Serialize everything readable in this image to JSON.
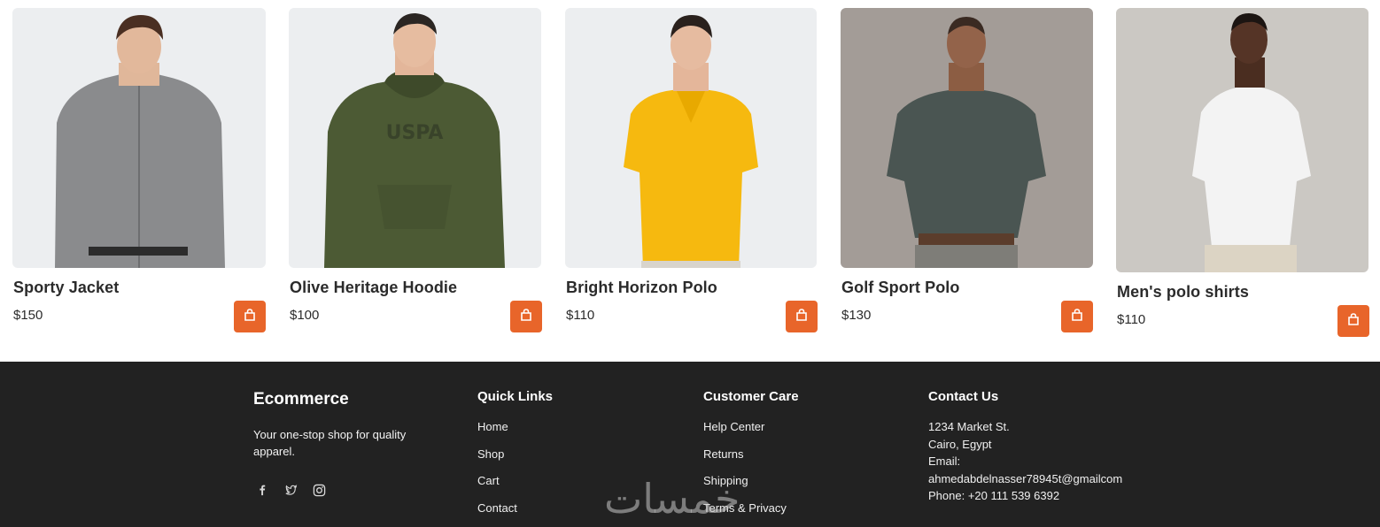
{
  "products": [
    {
      "title": "Sporty Jacket",
      "price": "$150",
      "image": "man-grey-jacket",
      "bg": "#eceef0",
      "garment": "#8a8b8d"
    },
    {
      "title": "Olive Heritage Hoodie",
      "price": "$100",
      "image": "man-olive-hoodie",
      "bg": "#eceef0",
      "garment": "#4c5a34"
    },
    {
      "title": "Bright Horizon Polo",
      "price": "$110",
      "image": "man-yellow-polo",
      "bg": "#eceef0",
      "garment": "#f6b90f"
    },
    {
      "title": "Golf Sport Polo",
      "price": "$130",
      "image": "man-dark-green-polo",
      "bg": "#a39c97",
      "garment": "#4a5552"
    },
    {
      "title": "Men's polo shirts",
      "price": "$110",
      "image": "man-white-polo",
      "bg": "#cbc8c3",
      "garment": "#f3f3f3"
    }
  ],
  "cart_icon": "shopping-bag-icon",
  "accent_color": "#e8652a",
  "footer": {
    "brand": "Ecommerce",
    "tagline": "Your one-stop shop for quality apparel.",
    "socials": [
      "facebook-icon",
      "twitter-icon",
      "instagram-icon"
    ],
    "quick_links": {
      "heading": "Quick Links",
      "items": [
        "Home",
        "Shop",
        "Cart",
        "Contact"
      ]
    },
    "customer_care": {
      "heading": "Customer Care",
      "items": [
        "Help Center",
        "Returns",
        "Shipping",
        "Terms & Privacy"
      ]
    },
    "contact": {
      "heading": "Contact Us",
      "lines": [
        "1234 Market St.",
        "Cairo, Egypt",
        "Email:",
        "ahmedabdelnasser78945t@gmailcom",
        "Phone: +20 111 539 6392"
      ]
    },
    "watermark": "خمسات"
  }
}
